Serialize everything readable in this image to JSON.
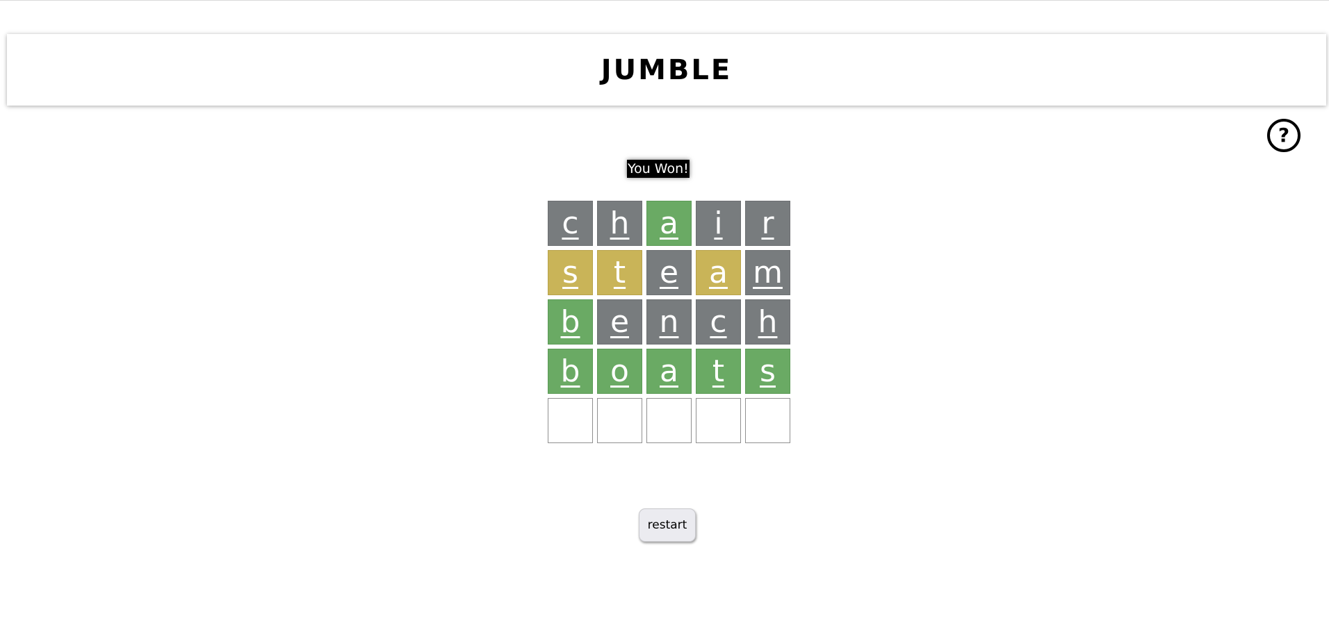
{
  "header": {
    "title": "JUMBLE"
  },
  "help": {
    "icon": "question-circle-icon",
    "glyph": "?"
  },
  "status": {
    "message": "You Won!"
  },
  "colors": {
    "absent": "#787c7e",
    "present": "#c9b458",
    "correct": "#6aaa64",
    "empty": "#ffffff"
  },
  "board": {
    "rows": [
      {
        "cells": [
          {
            "letter": "c",
            "state": "absent"
          },
          {
            "letter": "h",
            "state": "absent"
          },
          {
            "letter": "a",
            "state": "correct"
          },
          {
            "letter": "i",
            "state": "absent"
          },
          {
            "letter": "r",
            "state": "absent"
          }
        ]
      },
      {
        "cells": [
          {
            "letter": "s",
            "state": "present"
          },
          {
            "letter": "t",
            "state": "present"
          },
          {
            "letter": "e",
            "state": "absent"
          },
          {
            "letter": "a",
            "state": "present"
          },
          {
            "letter": "m",
            "state": "absent"
          }
        ]
      },
      {
        "cells": [
          {
            "letter": "b",
            "state": "correct"
          },
          {
            "letter": "e",
            "state": "absent"
          },
          {
            "letter": "n",
            "state": "absent"
          },
          {
            "letter": "c",
            "state": "absent"
          },
          {
            "letter": "h",
            "state": "absent"
          }
        ]
      },
      {
        "cells": [
          {
            "letter": "b",
            "state": "correct"
          },
          {
            "letter": "o",
            "state": "correct"
          },
          {
            "letter": "a",
            "state": "correct"
          },
          {
            "letter": "t",
            "state": "correct"
          },
          {
            "letter": "s",
            "state": "correct"
          }
        ]
      },
      {
        "cells": [
          {
            "letter": "",
            "state": "empty"
          },
          {
            "letter": "",
            "state": "empty"
          },
          {
            "letter": "",
            "state": "empty"
          },
          {
            "letter": "",
            "state": "empty"
          },
          {
            "letter": "",
            "state": "empty"
          }
        ]
      }
    ]
  },
  "controls": {
    "restart_label": "restart"
  }
}
